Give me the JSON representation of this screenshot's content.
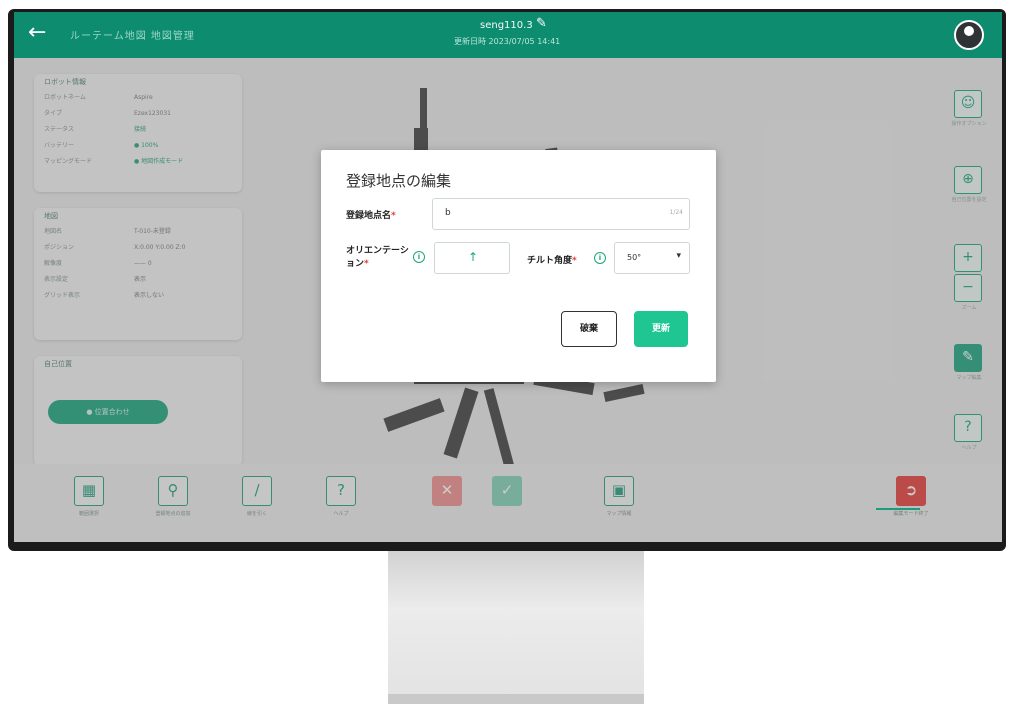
{
  "header": {
    "back_icon": "arrow-left-icon",
    "breadcrumb": "ルーテーム地図 地図管理",
    "map_name": "seng110.3",
    "map_subtitle": "更新日時 2023/07/05 14:41",
    "avatar_icon": "user-avatar-icon",
    "color": "#0e8c70"
  },
  "left_panels": {
    "robot": {
      "title": "ロボット情報",
      "rows": [
        {
          "label": "ロボットネーム",
          "value": "Aspire"
        },
        {
          "label": "タイプ",
          "value": "Ezex123031"
        },
        {
          "label": "ステータス",
          "value": "接続"
        },
        {
          "label": "バッテリー",
          "value": "● 100%"
        },
        {
          "label": "マッピングモード",
          "value": "● 地図作成モード"
        }
      ]
    },
    "map": {
      "title": "地図",
      "rows": [
        {
          "label": "地図名",
          "value": "T-010-未登録"
        },
        {
          "label": "ポジション",
          "value": "X:0.00 Y:0.00 Z:0"
        },
        {
          "label": "解像度",
          "value": "—— 0"
        },
        {
          "label": "表示設定",
          "value": "表示"
        },
        {
          "label": "グリッド表示",
          "value": "表示しない"
        }
      ]
    },
    "status": {
      "title": "自己位置",
      "button": "● 位置合わせ"
    }
  },
  "right_rail": [
    {
      "icon": "person-icon",
      "label": "操作オプション"
    },
    {
      "icon": "crosshair-icon",
      "label": "自己位置を設定"
    },
    {
      "icon": "zoom-icon",
      "label": "ズーム"
    },
    {
      "icon": "edit-icon",
      "label": "マップ編集"
    },
    {
      "icon": "help-icon",
      "label": "ヘルプ"
    }
  ],
  "toolbar": [
    {
      "icon": "select-area-icon",
      "label": "範囲選択"
    },
    {
      "icon": "location-pin-icon",
      "label": "登録地点の追加"
    },
    {
      "icon": "line-icon",
      "label": "線を引く"
    },
    {
      "icon": "help-icon",
      "label": "ヘルプ"
    },
    {
      "icon": "close-icon",
      "label": ""
    },
    {
      "icon": "check-icon",
      "label": ""
    },
    {
      "icon": "map-icon",
      "label": "マップ情報"
    },
    {
      "icon": "exit-icon",
      "label": "編集モード終了"
    }
  ],
  "modal": {
    "title": "登録地点の編集",
    "name_label": "登録地点名",
    "name_value": "b",
    "name_counter": "1/24",
    "orientation_label_1": "オリエンテーシ",
    "orientation_label_2": "ョン",
    "orientation_icon": "arrow-up-icon",
    "tilt_label": "チルト角度",
    "tilt_value": "50°",
    "required_mark": "*",
    "cancel_label": "破棄",
    "update_label": "更新",
    "accent_color": "#1fc691"
  }
}
